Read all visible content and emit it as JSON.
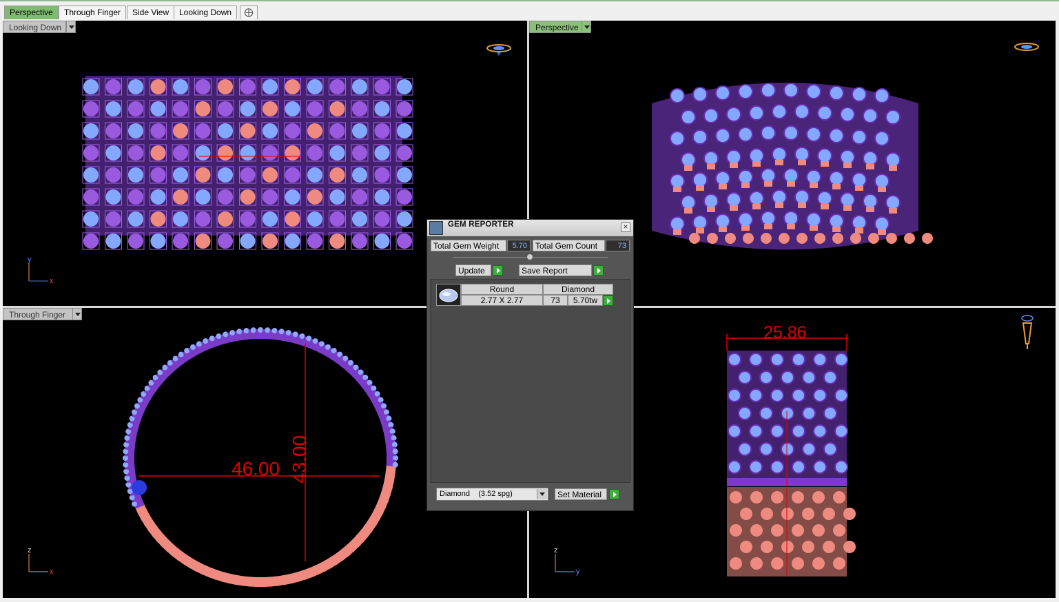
{
  "tabs": [
    {
      "label": "Perspective",
      "active": true
    },
    {
      "label": "Through Finger",
      "active": false
    },
    {
      "label": "Side View",
      "active": false
    },
    {
      "label": "Looking Down",
      "active": false
    }
  ],
  "viewports": {
    "top_left": {
      "label": "Looking Down",
      "axes": [
        "y",
        "x"
      ]
    },
    "top_right": {
      "label": "Perspective"
    },
    "bottom_left": {
      "label": "Through Finger",
      "axes": [
        "z",
        "x"
      ],
      "dimensions": [
        "46.00",
        "43.00"
      ]
    },
    "bottom_right": {
      "axes": [
        "z",
        "y"
      ],
      "dimensions": [
        "25.86"
      ]
    }
  },
  "gem_reporter": {
    "title": "GEM REPORTER",
    "total_gem_weight_label": "Total Gem Weight",
    "total_gem_weight": "5.70",
    "total_gem_count_label": "Total Gem Count",
    "total_gem_count": "73",
    "update_label": "Update",
    "save_report_label": "Save Report",
    "row": {
      "shape": "Round",
      "material": "Diamond",
      "size": "2.77 X 2.77",
      "count": "73",
      "weight": "5.70tw"
    },
    "material_select": "Diamond    (3.52 spg)",
    "set_material_label": "Set Material"
  },
  "colors": {
    "purple": "#7a3cc8",
    "salmon": "#ef8a80",
    "gem_blue": "#84a8ff",
    "dimension_red": "#e00000"
  }
}
